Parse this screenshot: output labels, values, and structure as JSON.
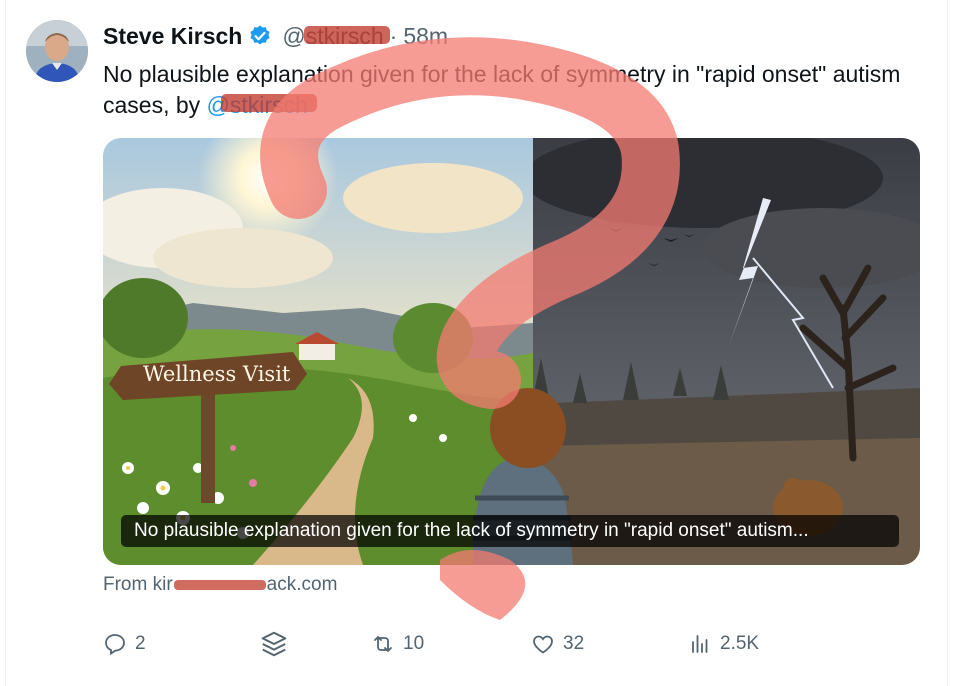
{
  "post": {
    "author_name": "Steve Kirsch",
    "handle": "@stkirsch",
    "time": "58m",
    "separator": "·",
    "text_main": "No plausible explanation given for the lack of symmetry in \"rapid onset\" autism cases, by ",
    "mention": "@stkirsch"
  },
  "media": {
    "sign_text": "Wellness Visit",
    "caption": "No plausible explanation given for the lack of symmetry in \"rapid onset\" autism..."
  },
  "source": {
    "prefix": "From ",
    "domain_start": "kir",
    "domain_end": "ack.com"
  },
  "actions": {
    "replies": "2",
    "reposts": "10",
    "likes": "32",
    "views": "2.5K"
  },
  "colors": {
    "accent": "#1d9bf0",
    "muted": "#536471",
    "overlay_mark": "#f47b72"
  },
  "icons": [
    "verified-badge-icon",
    "reply-icon",
    "stack-icon",
    "repost-icon",
    "like-icon",
    "views-icon"
  ]
}
